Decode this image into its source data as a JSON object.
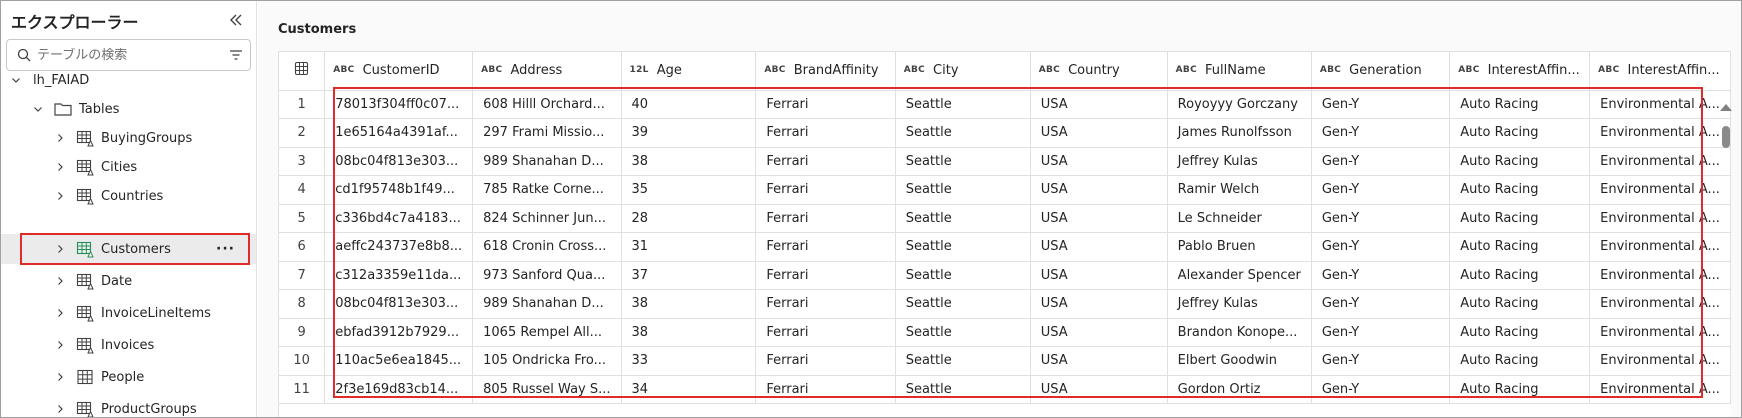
{
  "sidebar": {
    "title": "エクスプローラー",
    "search_placeholder": "テーブルの検索",
    "lakehouse": "lh_FAIAD",
    "folder": "Tables",
    "items": [
      {
        "label": "BuyingGroups"
      },
      {
        "label": "Cities"
      },
      {
        "label": "Countries"
      },
      {
        "label": "Customers",
        "selected": true
      },
      {
        "label": "Date"
      },
      {
        "label": "InvoiceLineItems"
      },
      {
        "label": "Invoices"
      },
      {
        "label": "People"
      },
      {
        "label": "ProductGroups"
      }
    ],
    "more_label": "···"
  },
  "main": {
    "title": "Customers",
    "columns": [
      {
        "type": "ABC",
        "name": "CustomerID"
      },
      {
        "type": "ABC",
        "name": "Address"
      },
      {
        "type": "12L",
        "name": "Age"
      },
      {
        "type": "ABC",
        "name": "BrandAffinity"
      },
      {
        "type": "ABC",
        "name": "City"
      },
      {
        "type": "ABC",
        "name": "Country"
      },
      {
        "type": "ABC",
        "name": "FullName"
      },
      {
        "type": "ABC",
        "name": "Generation"
      },
      {
        "type": "ABC",
        "name": "InterestAffin..."
      },
      {
        "type": "ABC",
        "name": "InterestAffin..."
      }
    ],
    "rows": [
      [
        "1",
        "78013f304ff0c07...",
        "608 Hilll Orchard...",
        "40",
        "Ferrari",
        "Seattle",
        "USA",
        "Royoyyy Gorczany",
        "Gen-Y",
        "Auto Racing",
        "Environmental A..."
      ],
      [
        "2",
        "1e65164a4391af...",
        "297 Frami Missio...",
        "39",
        "Ferrari",
        "Seattle",
        "USA",
        "James Runolfsson",
        "Gen-Y",
        "Auto Racing",
        "Environmental A..."
      ],
      [
        "3",
        "08bc04f813e303...",
        "989 Shanahan D...",
        "38",
        "Ferrari",
        "Seattle",
        "USA",
        "Jeffrey Kulas",
        "Gen-Y",
        "Auto Racing",
        "Environmental A..."
      ],
      [
        "4",
        "cd1f95748b1f49...",
        "785 Ratke Corne...",
        "35",
        "Ferrari",
        "Seattle",
        "USA",
        "Ramir Welch",
        "Gen-Y",
        "Auto Racing",
        "Environmental A..."
      ],
      [
        "5",
        "c336bd4c7a4183...",
        "824 Schinner Jun...",
        "28",
        "Ferrari",
        "Seattle",
        "USA",
        "Le Schneider",
        "Gen-Y",
        "Auto Racing",
        "Environmental A..."
      ],
      [
        "6",
        "aeffc243737e8b8...",
        "618 Cronin Cross...",
        "31",
        "Ferrari",
        "Seattle",
        "USA",
        "Pablo Bruen",
        "Gen-Y",
        "Auto Racing",
        "Environmental A..."
      ],
      [
        "7",
        "c312a3359e11da...",
        "973 Sanford Qua...",
        "37",
        "Ferrari",
        "Seattle",
        "USA",
        "Alexander Spencer",
        "Gen-Y",
        "Auto Racing",
        "Environmental A..."
      ],
      [
        "8",
        "08bc04f813e303...",
        "989 Shanahan D...",
        "38",
        "Ferrari",
        "Seattle",
        "USA",
        "Jeffrey Kulas",
        "Gen-Y",
        "Auto Racing",
        "Environmental A..."
      ],
      [
        "9",
        "ebfad3912b7929...",
        "1065 Rempel All...",
        "38",
        "Ferrari",
        "Seattle",
        "USA",
        "Brandon Konope...",
        "Gen-Y",
        "Auto Racing",
        "Environmental A..."
      ],
      [
        "10",
        "110ac5e6ea1845...",
        "105 Ondricka Fro...",
        "33",
        "Ferrari",
        "Seattle",
        "USA",
        "Elbert Goodwin",
        "Gen-Y",
        "Auto Racing",
        "Environmental A..."
      ],
      [
        "11",
        "2f3e169d83cb14...",
        "805 Russel Way S...",
        "34",
        "Ferrari",
        "Seattle",
        "USA",
        "Gordon Ortiz",
        "Gen-Y",
        "Auto Racing",
        "Environmental A..."
      ]
    ]
  },
  "colors": {
    "highlight": "#e02b2b",
    "selected_bg": "#ebebeb",
    "table_icon": "#2b8a5a"
  }
}
